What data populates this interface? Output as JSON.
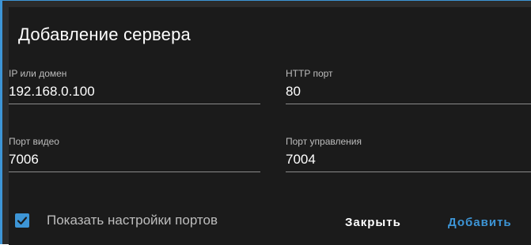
{
  "dialog": {
    "title": "Добавление сервера"
  },
  "fields": {
    "ip": {
      "label": "IP или домен",
      "value": "192.168.0.100"
    },
    "http_port": {
      "label": "HTTP порт",
      "value": "80"
    },
    "video_port": {
      "label": "Порт видео",
      "value": "7006"
    },
    "control_port": {
      "label": "Порт управления",
      "value": "7004"
    }
  },
  "checkbox": {
    "label": "Показать настройки портов",
    "checked": true
  },
  "buttons": {
    "close_label": "Закрыть",
    "add_label": "Добавить"
  },
  "colors": {
    "accent": "#3d95d6",
    "background": "#1b1b1b"
  }
}
